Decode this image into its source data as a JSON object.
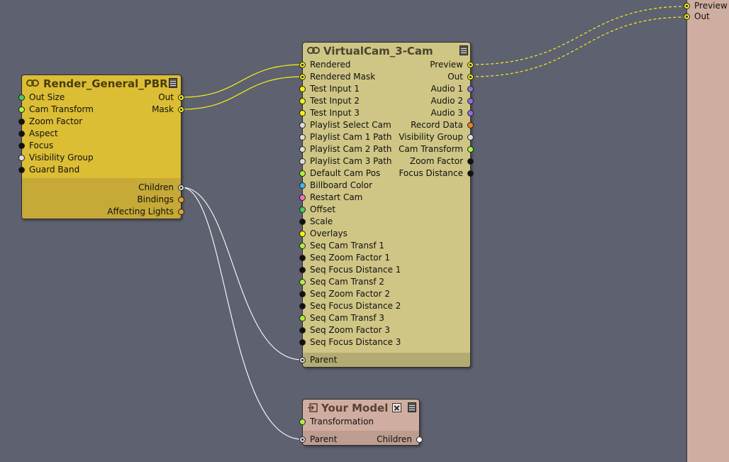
{
  "nodes": {
    "render": {
      "title": "Render_General_PBR",
      "inputs": [
        {
          "label": "Out Size",
          "color": "#4cc864"
        },
        {
          "label": "Cam Transform",
          "color": "#aaf040"
        },
        {
          "label": "Zoom Factor",
          "color": "#111111"
        },
        {
          "label": "Aspect",
          "color": "#111111"
        },
        {
          "label": "Focus",
          "color": "#111111"
        },
        {
          "label": "Visibility Group",
          "color": "#dddddd"
        },
        {
          "label": "Guard Band",
          "color": "#111111"
        }
      ],
      "outputs": [
        {
          "label": "Out",
          "color": "#f5f010",
          "hollow": true
        },
        {
          "label": "Mask",
          "color": "#f5f010",
          "hollow": true
        }
      ],
      "footer_outputs": [
        {
          "label": "Children",
          "color": "#dddddd",
          "hollow": true
        },
        {
          "label": "Bindings",
          "color": "#e6a030"
        },
        {
          "label": "Affecting Lights",
          "color": "#e6a030"
        }
      ]
    },
    "vcam": {
      "title": "VirtualCam_3-Cam",
      "inputs": [
        {
          "label": "Rendered",
          "color": "#f5f010",
          "hollow": true
        },
        {
          "label": "Rendered Mask",
          "color": "#f5f010",
          "hollow": true
        },
        {
          "label": "Test Input 1",
          "color": "#f5f010"
        },
        {
          "label": "Test Input 2",
          "color": "#f5f010"
        },
        {
          "label": "Test Input 3",
          "color": "#f5f010"
        },
        {
          "label": "Playlist Select Cam",
          "color": "#dddddd"
        },
        {
          "label": "Playlist Cam 1 Path",
          "color": "#dddddd"
        },
        {
          "label": "Playlist Cam 2 Path",
          "color": "#dddddd"
        },
        {
          "label": "Playlist Cam 3 Path",
          "color": "#dddddd"
        },
        {
          "label": "Default Cam Pos",
          "color": "#aaf040"
        },
        {
          "label": "Billboard Color",
          "color": "#40b8e0"
        },
        {
          "label": "Restart Cam",
          "color": "#f070c8"
        },
        {
          "label": "Offset",
          "color": "#4cc864"
        },
        {
          "label": "Scale",
          "color": "#111111"
        },
        {
          "label": "Overlays",
          "color": "#f5f010"
        },
        {
          "label": "Seq Cam Transf 1",
          "color": "#aaf040"
        },
        {
          "label": "Seq Zoom Factor 1",
          "color": "#111111"
        },
        {
          "label": "Seq Focus Distance 1",
          "color": "#111111"
        },
        {
          "label": "Seq Cam Transf 2",
          "color": "#aaf040"
        },
        {
          "label": "Seq Zoom Factor 2",
          "color": "#111111"
        },
        {
          "label": "Seq Focus Distance 2",
          "color": "#111111"
        },
        {
          "label": "Seq Cam Transf 3",
          "color": "#aaf040"
        },
        {
          "label": "Seq Zoom Factor 3",
          "color": "#111111"
        },
        {
          "label": "Seq Focus Distance 3",
          "color": "#111111"
        }
      ],
      "outputs": [
        {
          "label": "Preview",
          "color": "#f5f010",
          "hollow": true
        },
        {
          "label": "Out",
          "color": "#f5f010",
          "hollow": true
        },
        {
          "label": "Audio 1",
          "color": "#9070d8"
        },
        {
          "label": "Audio 2",
          "color": "#9070d8"
        },
        {
          "label": "Audio 3",
          "color": "#9070d8"
        },
        {
          "label": "Record Data",
          "color": "#f08020"
        },
        {
          "label": "Visibility Group",
          "color": "#dddddd"
        },
        {
          "label": "Cam Transform",
          "color": "#aaf040"
        },
        {
          "label": "Zoom Factor",
          "color": "#111111"
        },
        {
          "label": "Focus Distance",
          "color": "#111111"
        }
      ],
      "footer_inputs": [
        {
          "label": "Parent",
          "color": "#dddddd",
          "hollow": true
        }
      ]
    },
    "model": {
      "title": "Your Model",
      "inputs": [
        {
          "label": "Transformation",
          "color": "#aaf040"
        }
      ],
      "footer_inputs": [
        {
          "label": "Parent",
          "color": "#dddddd",
          "hollow": true
        }
      ],
      "footer_outputs": [
        {
          "label": "Children",
          "color": "#ffffff"
        }
      ]
    }
  },
  "output_panel": {
    "ports": [
      {
        "label": "Preview",
        "color": "#f5f010",
        "hollow": true
      },
      {
        "label": "Out",
        "color": "#f5f010",
        "hollow": true
      }
    ]
  },
  "colors": {
    "canvas": "#5e6170",
    "render_node": "#dcbe35",
    "render_footer": "#c6a936",
    "vcam_node": "#cfc585",
    "vcam_footer": "#b3ab72",
    "model_node": "#cfada0",
    "model_footer": "#bd9d90",
    "wire_yellow": "#f5f010",
    "wire_white": "#ffffff"
  }
}
